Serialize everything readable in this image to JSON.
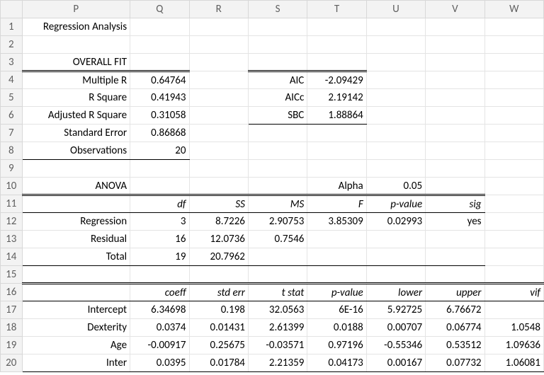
{
  "columns": [
    "P",
    "Q",
    "R",
    "S",
    "T",
    "U",
    "V",
    "W"
  ],
  "rows": [
    "1",
    "2",
    "3",
    "4",
    "5",
    "6",
    "7",
    "8",
    "9",
    "10",
    "11",
    "12",
    "13",
    "14",
    "15",
    "16",
    "17",
    "18",
    "19",
    "20"
  ],
  "title": "Regression Analysis",
  "overall_fit": {
    "heading": "OVERALL FIT",
    "labels": {
      "multiple_r": "Multiple R",
      "r_square": "R Square",
      "adj_r_square": "Adjusted R Square",
      "std_error": "Standard Error",
      "observations": "Observations",
      "aic": "AIC",
      "aicc": "AICc",
      "sbc": "SBC"
    },
    "values": {
      "multiple_r": "0.64764",
      "r_square": "0.41943",
      "adj_r_square": "0.31058",
      "std_error": "0.86868",
      "observations": "20",
      "aic": "-2.09429",
      "aicc": "2.19142",
      "sbc": "1.88864"
    }
  },
  "anova": {
    "heading": "ANOVA",
    "alpha_label": "Alpha",
    "alpha_value": "0.05",
    "headers": {
      "df": "df",
      "ss": "SS",
      "ms": "MS",
      "f": "F",
      "p": "p-value",
      "sig": "sig"
    },
    "rows": {
      "regression": {
        "label": "Regression",
        "df": "3",
        "ss": "8.7226",
        "ms": "2.90753",
        "f": "3.85309",
        "p": "0.02993",
        "sig": "yes"
      },
      "residual": {
        "label": "Residual",
        "df": "16",
        "ss": "12.0736",
        "ms": "0.7546"
      },
      "total": {
        "label": "Total",
        "df": "19",
        "ss": "20.7962"
      }
    }
  },
  "coeff": {
    "headers": {
      "coeff": "coeff",
      "se": "std err",
      "t": "t stat",
      "p": "p-value",
      "lo": "lower",
      "hi": "upper",
      "vif": "vif"
    },
    "rows": {
      "intercept": {
        "label": "Intercept",
        "coeff": "6.34698",
        "se": "0.198",
        "t": "32.0563",
        "p": "6E-16",
        "lo": "5.92725",
        "hi": "6.76672",
        "vif": ""
      },
      "dexterity": {
        "label": "Dexterity",
        "coeff": "0.0374",
        "se": "0.01431",
        "t": "2.61399",
        "p": "0.0188",
        "lo": "0.00707",
        "hi": "0.06774",
        "vif": "1.0548"
      },
      "age": {
        "label": "Age",
        "coeff": "-0.00917",
        "se": "0.25675",
        "t": "-0.03571",
        "p": "0.97196",
        "lo": "-0.55346",
        "hi": "0.53512",
        "vif": "1.09636"
      },
      "inter": {
        "label": "Inter",
        "coeff": "0.0395",
        "se": "0.01784",
        "t": "2.21359",
        "p": "0.04173",
        "lo": "0.00167",
        "hi": "0.07732",
        "vif": "1.06081"
      }
    }
  },
  "chart_data": {
    "type": "table",
    "title": "Regression Analysis",
    "overall_fit": {
      "Multiple R": 0.64764,
      "R Square": 0.41943,
      "Adjusted R Square": 0.31058,
      "Standard Error": 0.86868,
      "Observations": 20,
      "AIC": -2.09429,
      "AICc": 2.19142,
      "SBC": 1.88864
    },
    "anova": {
      "alpha": 0.05,
      "columns": [
        "df",
        "SS",
        "MS",
        "F",
        "p-value",
        "sig"
      ],
      "rows": [
        {
          "label": "Regression",
          "df": 3,
          "SS": 8.7226,
          "MS": 2.90753,
          "F": 3.85309,
          "p-value": 0.02993,
          "sig": "yes"
        },
        {
          "label": "Residual",
          "df": 16,
          "SS": 12.0736,
          "MS": 0.7546
        },
        {
          "label": "Total",
          "df": 19,
          "SS": 20.7962
        }
      ]
    },
    "coefficients": {
      "columns": [
        "coeff",
        "std err",
        "t stat",
        "p-value",
        "lower",
        "upper",
        "vif"
      ],
      "rows": [
        {
          "label": "Intercept",
          "coeff": 6.34698,
          "std err": 0.198,
          "t stat": 32.0563,
          "p-value": 6e-16,
          "lower": 5.92725,
          "upper": 6.76672
        },
        {
          "label": "Dexterity",
          "coeff": 0.0374,
          "std err": 0.01431,
          "t stat": 2.61399,
          "p-value": 0.0188,
          "lower": 0.00707,
          "upper": 0.06774,
          "vif": 1.0548
        },
        {
          "label": "Age",
          "coeff": -0.00917,
          "std err": 0.25675,
          "t stat": -0.03571,
          "p-value": 0.97196,
          "lower": -0.55346,
          "upper": 0.53512,
          "vif": 1.09636
        },
        {
          "label": "Inter",
          "coeff": 0.0395,
          "std err": 0.01784,
          "t stat": 2.21359,
          "p-value": 0.04173,
          "lower": 0.00167,
          "upper": 0.07732,
          "vif": 1.06081
        }
      ]
    }
  }
}
